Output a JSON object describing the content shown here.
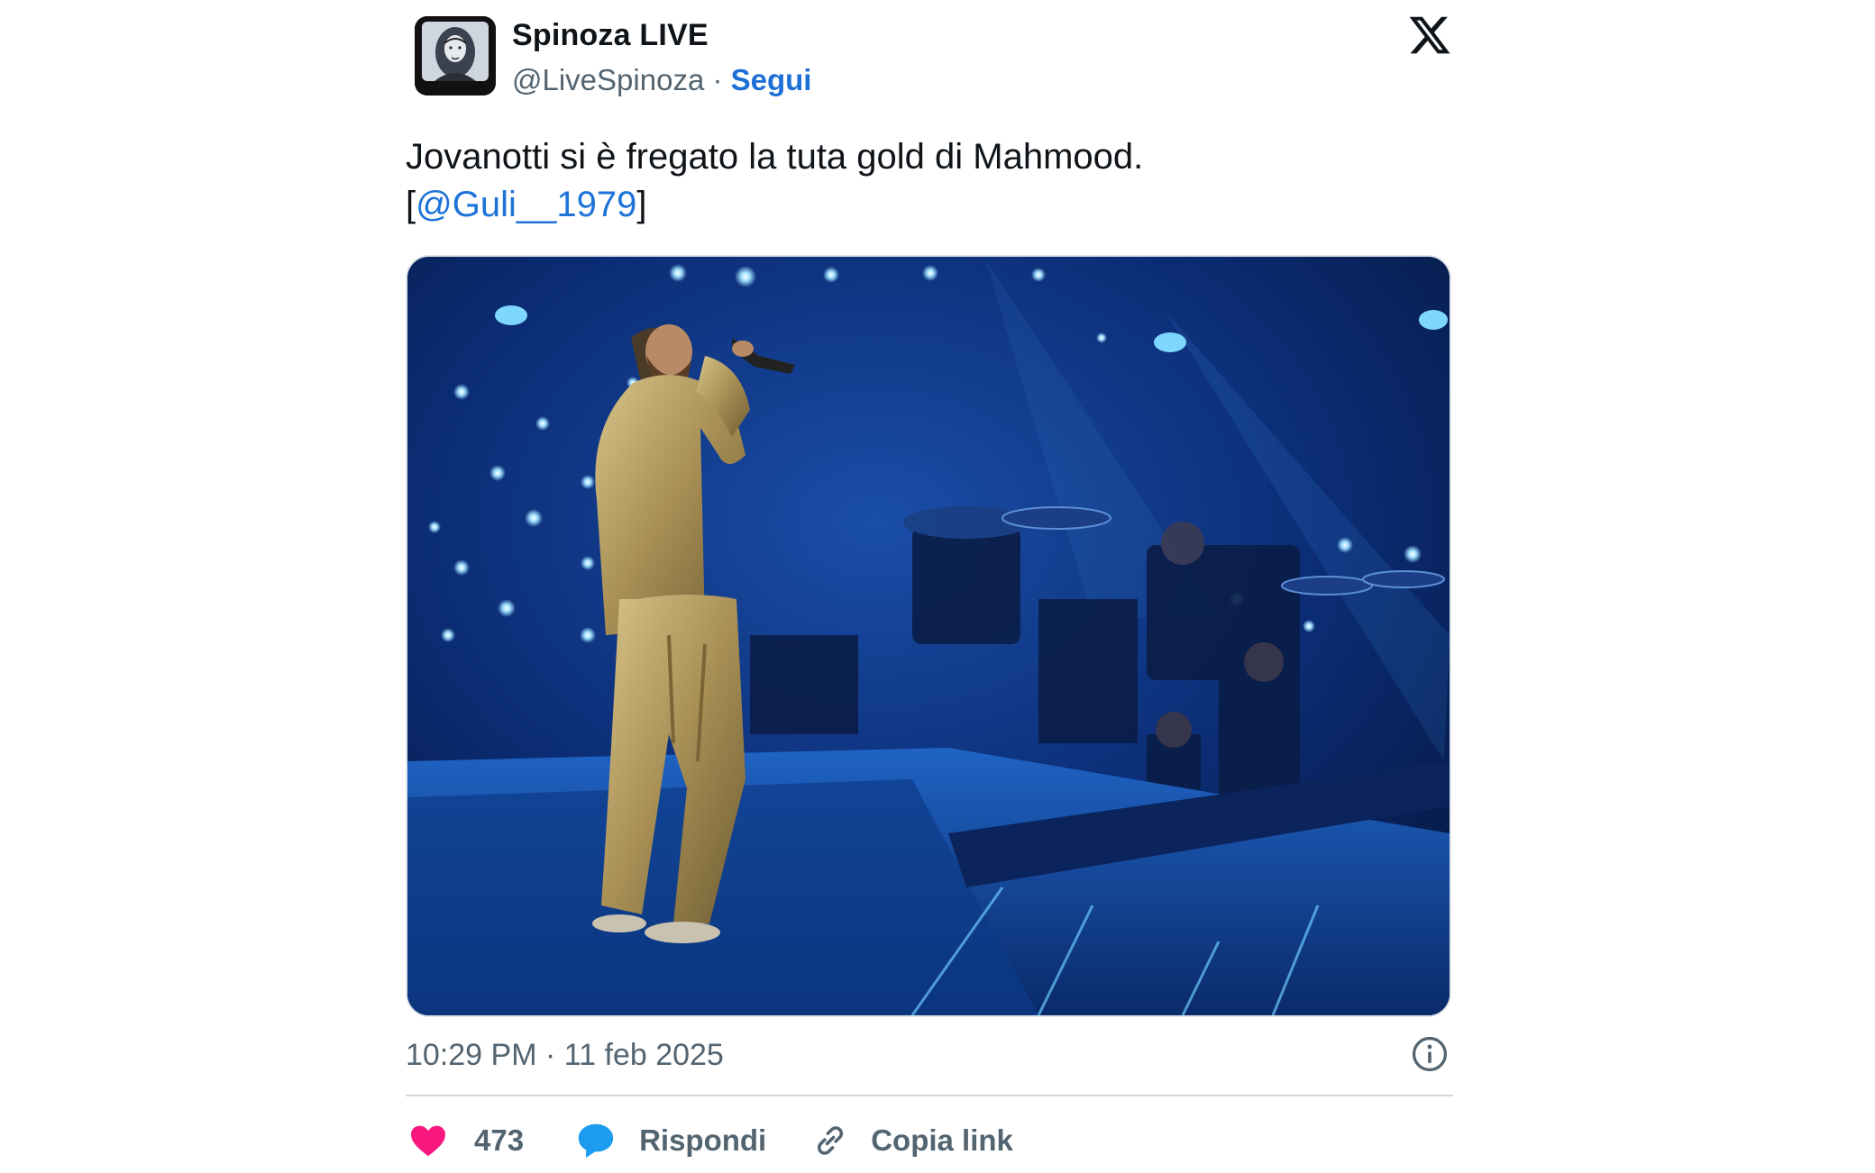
{
  "author": {
    "display_name": "Spinoza LIVE",
    "handle": "@LiveSpinoza",
    "separator": " · ",
    "follow_label": "Segui",
    "avatar_icon": "spinoza-portrait-avatar"
  },
  "platform_icon": "x-logo-icon",
  "tweet": {
    "text_line1": "Jovanotti si è fregato la tuta gold di Mahmood.",
    "mention_open": "[",
    "mention": "@Guli__1979",
    "mention_close": "]"
  },
  "media": {
    "kind": "video-frame",
    "icon": "concert-stage-photo"
  },
  "meta": {
    "time": "10:29 PM",
    "separator": " · ",
    "date": "11 feb 2025",
    "info_icon": "info-icon"
  },
  "actions": {
    "like_count": "473",
    "like_icon": "heart-icon",
    "reply_label": "Rispondi",
    "reply_icon": "speech-bubble-icon",
    "copy_label": "Copia link",
    "copy_icon": "link-icon"
  },
  "colors": {
    "text": "#0f1419",
    "secondary": "#536471",
    "link": "#1d73d8",
    "heart": "#f91880",
    "reply": "#1d9bf0"
  }
}
